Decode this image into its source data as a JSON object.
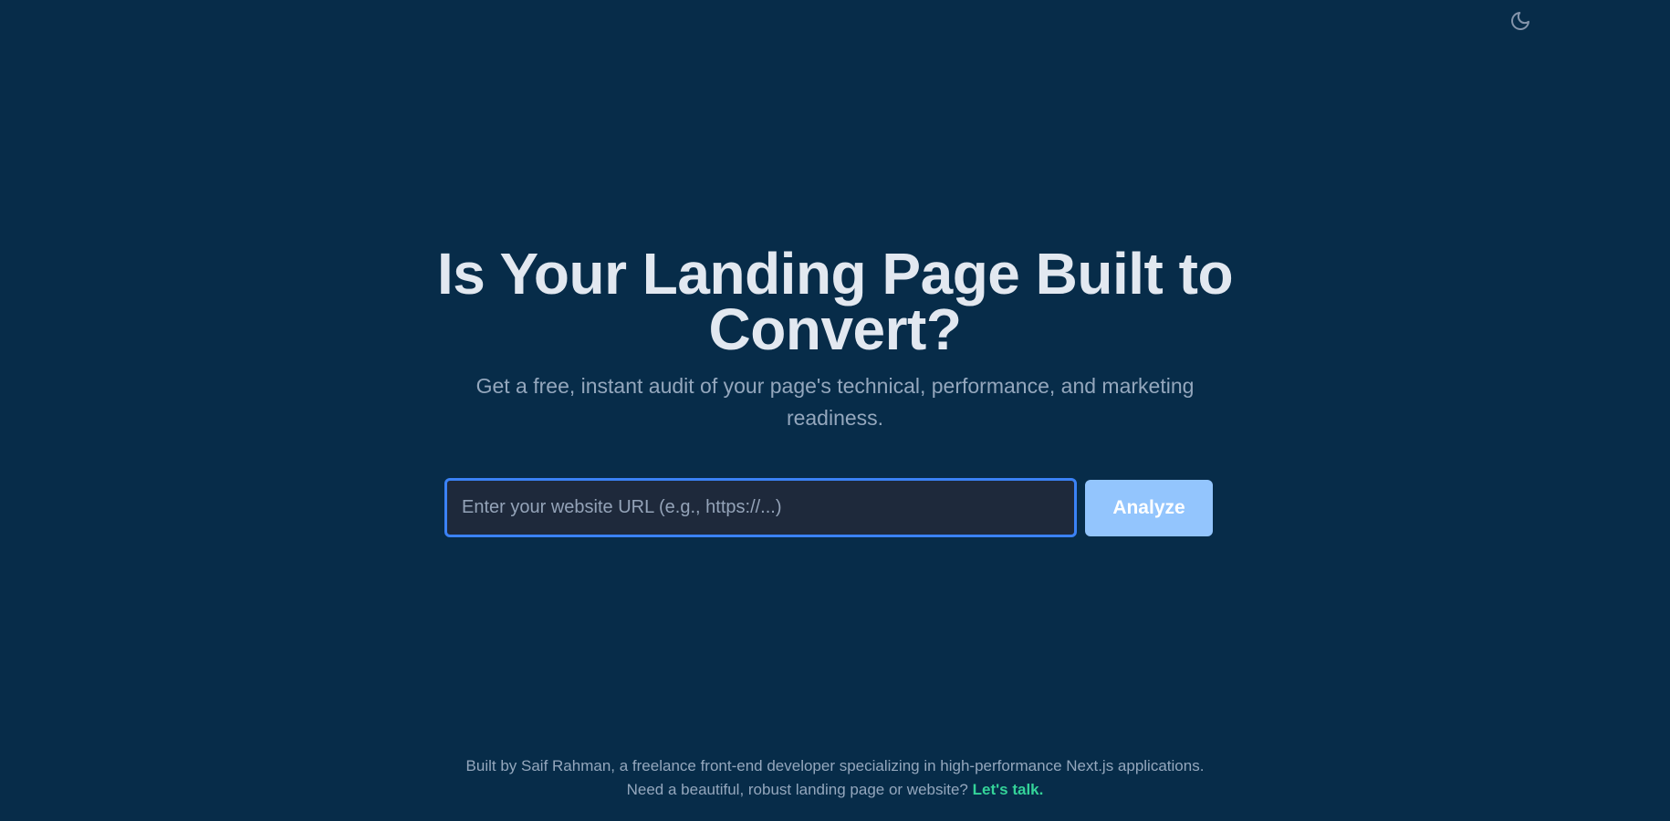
{
  "header": {
    "theme_toggle_icon": "moon-icon"
  },
  "hero": {
    "title": "Is Your Landing Page Built to Convert?",
    "subtitle": "Get a free, instant audit of your page's technical, performance, and marketing readiness."
  },
  "form": {
    "url_input_value": "",
    "url_input_placeholder": "Enter your website URL (e.g., https://...)",
    "analyze_label": "Analyze"
  },
  "footer": {
    "line1": "Built by Saif Rahman, a freelance front-end developer specializing in high-performance Next.js applications.",
    "line2_text": "Need a beautiful, robust landing page or website?",
    "cta_label": "Let's talk."
  },
  "colors": {
    "background": "#072c49",
    "title_text": "#e2e8f0",
    "muted_text": "#94a7bd",
    "input_background": "#1e293b",
    "input_border": "#3b82f6",
    "button_background": "#93c5fd",
    "cta_link": "#34d399"
  }
}
